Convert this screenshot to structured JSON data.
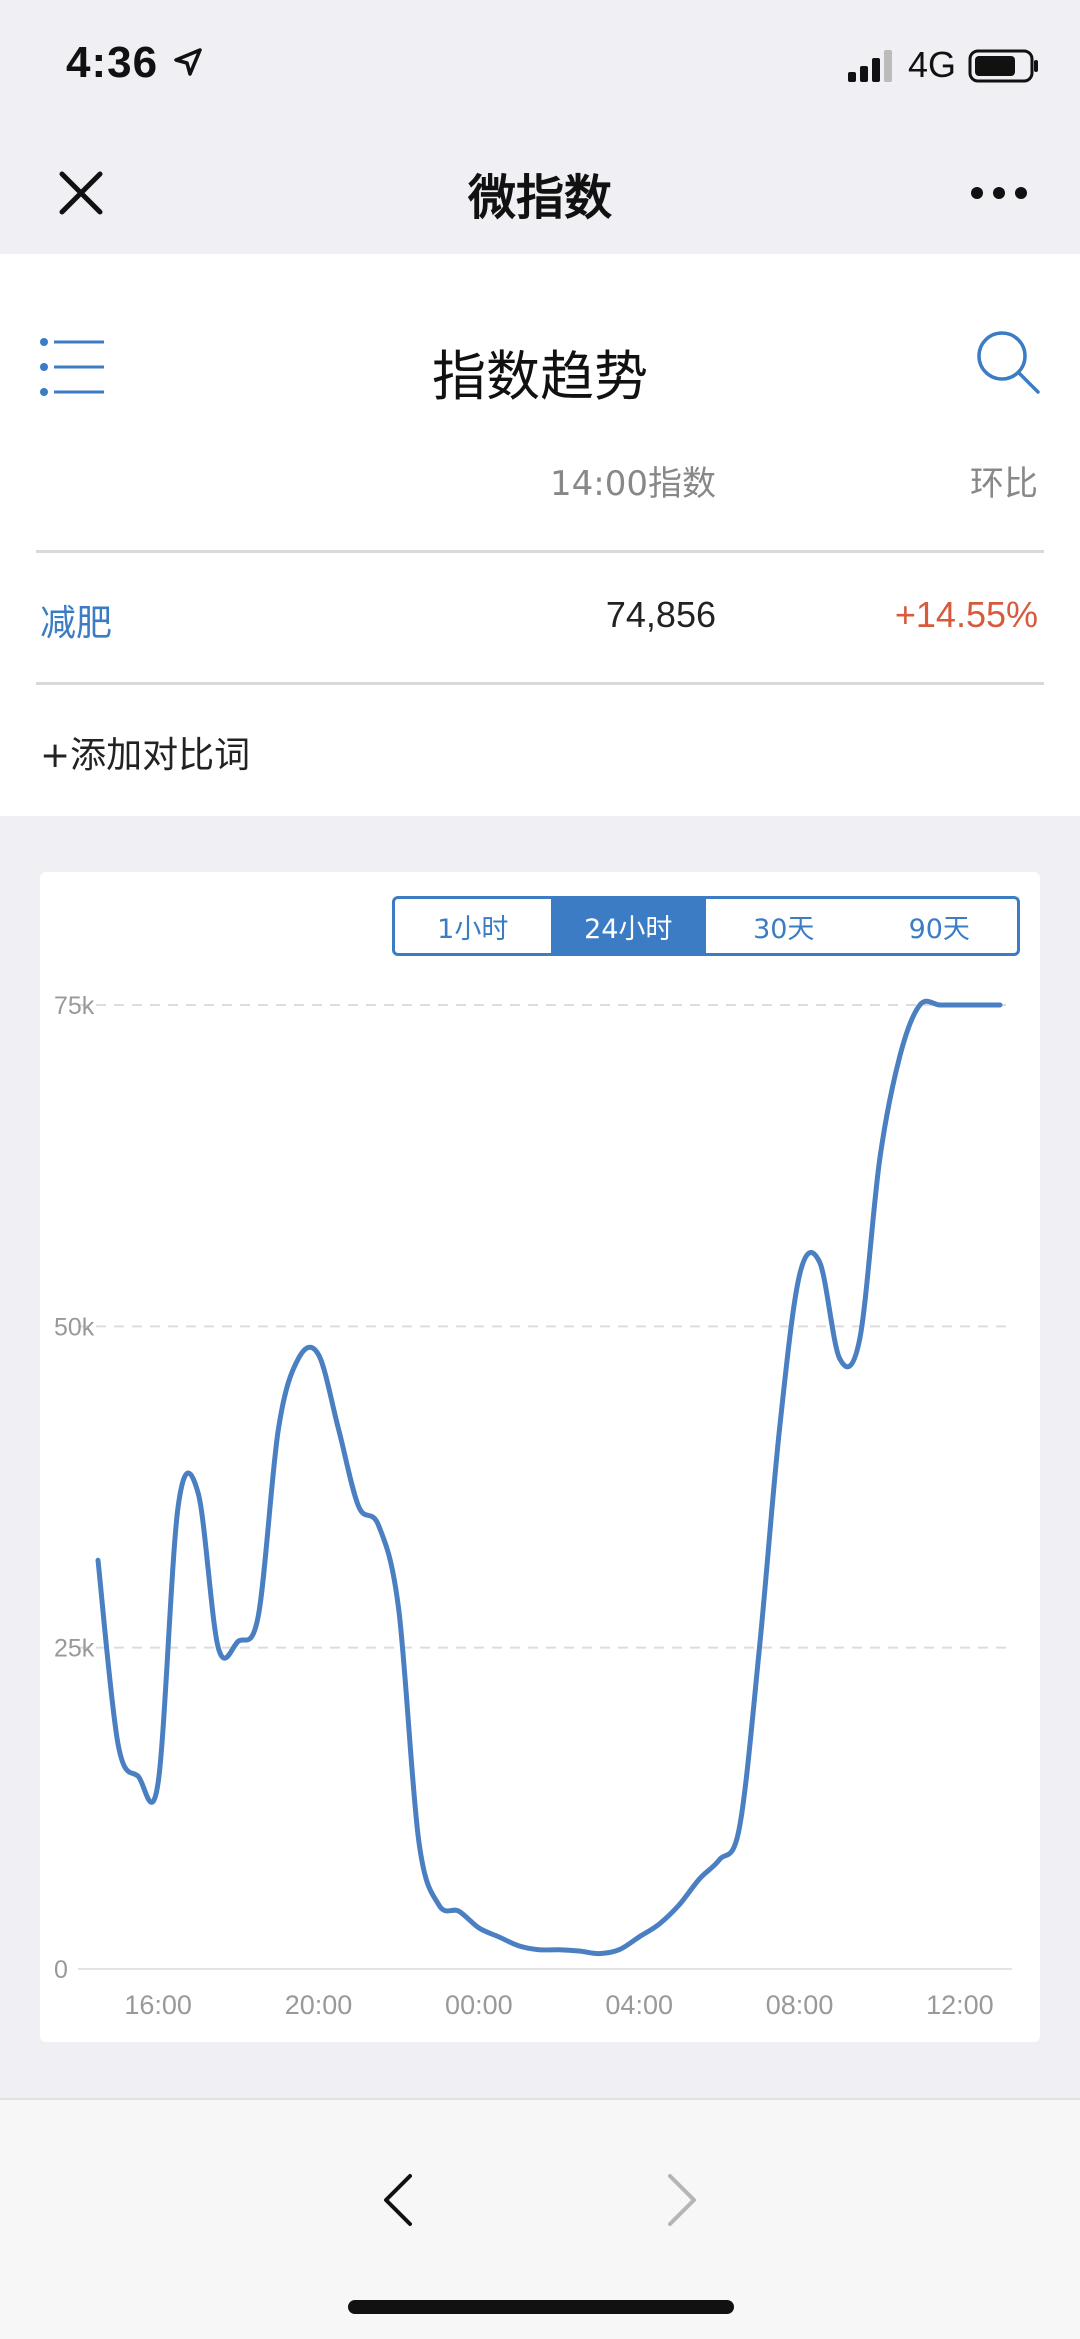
{
  "status_bar": {
    "time": "4:36",
    "network": "4G",
    "icons": [
      "location-arrow-icon",
      "signal-bars-icon",
      "battery-icon"
    ]
  },
  "nav": {
    "title": "微指数",
    "close_icon": "close-icon",
    "more_icon": "more-dots-icon"
  },
  "panel": {
    "title": "指数趋势",
    "col_index": "14:00指数",
    "col_change": "环比",
    "row": {
      "term": "减肥",
      "index": "74,856",
      "change": "+14.55%"
    },
    "add_compare": "+添加对比词",
    "menu_icon": "list-menu-icon",
    "search_icon": "search-icon"
  },
  "range_tabs": [
    {
      "label": "1小时",
      "active": false
    },
    {
      "label": "24小时",
      "active": true
    },
    {
      "label": "30天",
      "active": false
    },
    {
      "label": "90天",
      "active": false
    }
  ],
  "colors": {
    "accent": "#3b7cc5",
    "positive_change": "#d85a3d",
    "line": "#4a7fc1",
    "grid": "#dddddd"
  },
  "chart_data": {
    "type": "line",
    "ylim": [
      0,
      75000
    ],
    "y_ticks": [
      {
        "value": 0,
        "label": "0"
      },
      {
        "value": 25000,
        "label": "25k"
      },
      {
        "value": 50000,
        "label": "50k"
      },
      {
        "value": 75000,
        "label": "75k"
      }
    ],
    "x_range": [
      14.5,
      37.0
    ],
    "x_ticks": [
      {
        "value": 16,
        "label": "16:00"
      },
      {
        "value": 20,
        "label": "20:00"
      },
      {
        "value": 24,
        "label": "00:00"
      },
      {
        "value": 28,
        "label": "04:00"
      },
      {
        "value": 32,
        "label": "08:00"
      },
      {
        "value": 36,
        "label": "12:00"
      }
    ],
    "grid": true,
    "series": [
      {
        "x": [
          14.5,
          15.0,
          15.5,
          16.0,
          16.5,
          17.0,
          17.5,
          18.0,
          18.5,
          19.0,
          19.5,
          20.0,
          20.5,
          21.0,
          21.5,
          22.0,
          22.5,
          23.0,
          23.5,
          24.0,
          24.5,
          25.0,
          25.5,
          26.0,
          26.5,
          27.0,
          27.5,
          28.0,
          28.5,
          29.0,
          29.5,
          30.0,
          30.5,
          31.0,
          31.5,
          32.0,
          32.5,
          33.0,
          33.5,
          34.0,
          34.5,
          35.0,
          35.5,
          36.0,
          36.5,
          37.0
        ],
        "y": [
          31800,
          17500,
          15000,
          14500,
          36000,
          37000,
          25000,
          25500,
          27500,
          42000,
          47500,
          47800,
          42000,
          36000,
          34500,
          28000,
          10000,
          5000,
          4500,
          3200,
          2500,
          1800,
          1500,
          1500,
          1400,
          1200,
          1500,
          2500,
          3500,
          5000,
          7000,
          8500,
          11000,
          25000,
          42000,
          54000,
          55000,
          47500,
          49000,
          63000,
          71000,
          75000,
          75000,
          75000,
          75000,
          75000
        ]
      }
    ]
  },
  "bottom_bar": {
    "back_icon": "chevron-left-icon",
    "forward_icon": "chevron-right-icon"
  }
}
